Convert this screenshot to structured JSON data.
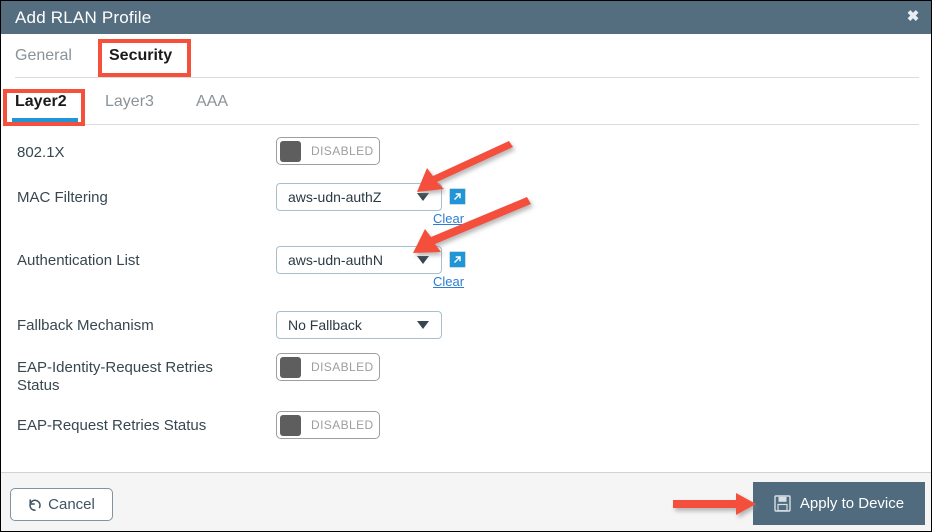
{
  "window": {
    "title": "Add RLAN Profile",
    "close_icon": "close-icon",
    "titlebar_color": "#546e7f"
  },
  "primary_tabs": [
    {
      "label": "General",
      "active": false
    },
    {
      "label": "Security",
      "active": true
    }
  ],
  "secondary_tabs": [
    {
      "label": "Layer2",
      "active": true
    },
    {
      "label": "Layer3",
      "active": false
    },
    {
      "label": "AAA",
      "active": false
    }
  ],
  "fields": {
    "dot1x": {
      "label": "802.1X",
      "toggle_state": "DISABLED"
    },
    "mac_filtering": {
      "label": "MAC Filtering",
      "value": "aws-udn-authZ",
      "clear_label": "Clear",
      "ext_link_icon": "external-link-icon"
    },
    "authentication_list": {
      "label": "Authentication List",
      "value": "aws-udn-authN",
      "clear_label": "Clear",
      "ext_link_icon": "external-link-icon"
    },
    "fallback_mechanism": {
      "label": "Fallback Mechanism",
      "value": "No Fallback"
    },
    "eap_identity_request_retries": {
      "label": "EAP-Identity-Request Retries Status",
      "toggle_state": "DISABLED"
    },
    "eap_request_retries": {
      "label": "EAP-Request Retries Status",
      "toggle_state": "DISABLED"
    }
  },
  "footer": {
    "cancel_label": "Cancel",
    "cancel_icon": "undo-arrow-icon",
    "apply_label": "Apply to Device",
    "apply_icon": "save-floppy-icon",
    "apply_color": "#4f6b7d"
  },
  "annotations": {
    "highlight_color": "#f4503c",
    "boxes": [
      "security-tab",
      "layer2-tab"
    ],
    "arrows": [
      "mac-filtering-arrow",
      "authentication-list-arrow",
      "apply-to-device-arrow"
    ]
  }
}
